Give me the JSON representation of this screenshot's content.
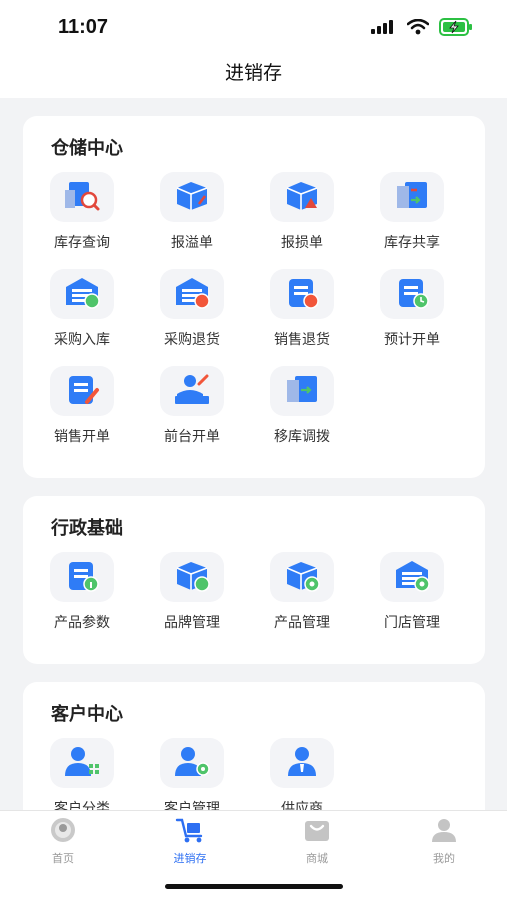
{
  "status_bar": {
    "time": "11:07"
  },
  "navbar": {
    "title": "进销存"
  },
  "sections": [
    {
      "title": "仓储中心",
      "items": [
        {
          "label": "库存查询",
          "icon": "inventory-search-icon"
        },
        {
          "label": "报溢单",
          "icon": "overflow-report-icon"
        },
        {
          "label": "报损单",
          "icon": "loss-report-icon"
        },
        {
          "label": "库存共享",
          "icon": "inventory-share-icon"
        },
        {
          "label": "采购入库",
          "icon": "purchase-inbound-icon"
        },
        {
          "label": "采购退货",
          "icon": "purchase-return-icon"
        },
        {
          "label": "销售退货",
          "icon": "sales-return-icon"
        },
        {
          "label": "预计开单",
          "icon": "scheduled-order-icon"
        },
        {
          "label": "销售开单",
          "icon": "sales-order-icon"
        },
        {
          "label": "前台开单",
          "icon": "front-desk-order-icon"
        },
        {
          "label": "移库调拨",
          "icon": "stock-transfer-icon"
        }
      ]
    },
    {
      "title": "行政基础",
      "items": [
        {
          "label": "产品参数",
          "icon": "product-params-icon"
        },
        {
          "label": "品牌管理",
          "icon": "brand-management-icon"
        },
        {
          "label": "产品管理",
          "icon": "product-management-icon"
        },
        {
          "label": "门店管理",
          "icon": "store-management-icon"
        }
      ]
    },
    {
      "title": "客户中心",
      "items": [
        {
          "label": "客户分类",
          "icon": "customer-category-icon"
        },
        {
          "label": "客户管理",
          "icon": "customer-management-icon"
        },
        {
          "label": "供应商",
          "icon": "supplier-icon"
        }
      ]
    }
  ],
  "tabbar": [
    {
      "label": "首页",
      "icon": "home-avatar-icon",
      "active": false
    },
    {
      "label": "进销存",
      "icon": "cart-icon",
      "active": true
    },
    {
      "label": "商城",
      "icon": "mall-icon",
      "active": false
    },
    {
      "label": "我的",
      "icon": "profile-icon",
      "active": false
    }
  ],
  "colors": {
    "accent": "#2d6ff2",
    "icon_blue": "#2f7cf6",
    "tab_inactive": "#9a9a9a"
  }
}
